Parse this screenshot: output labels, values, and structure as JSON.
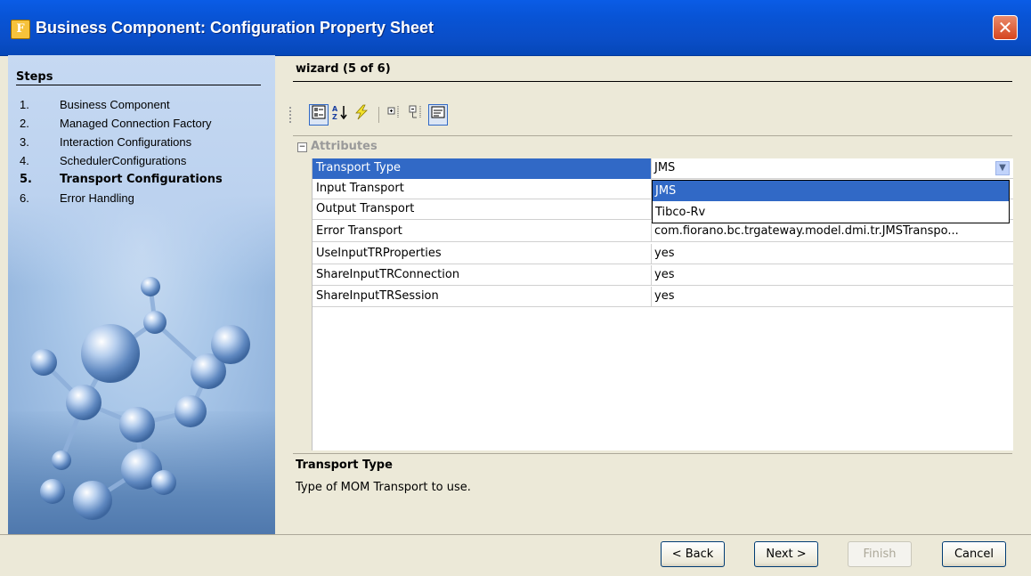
{
  "window": {
    "title": "Business Component: Configuration Property Sheet",
    "app_icon": "F",
    "close_glyph": "✕"
  },
  "sidebar": {
    "heading": "Steps",
    "steps": [
      {
        "num": "1.",
        "label": "Business Component"
      },
      {
        "num": "2.",
        "label": "Managed Connection Factory"
      },
      {
        "num": "3.",
        "label": "Interaction Configurations"
      },
      {
        "num": "4.",
        "label": "SchedulerConfigurations"
      },
      {
        "num": "5.",
        "label": "Transport Configurations"
      },
      {
        "num": "6.",
        "label": "Error Handling"
      }
    ],
    "current_step": 5
  },
  "main": {
    "heading": "wizard (5 of 6)",
    "toolbar": [
      {
        "icon": "categorized-view-icon"
      },
      {
        "icon": "sort-alphabetic-icon"
      },
      {
        "icon": "events-lightning-icon"
      },
      {
        "icon": "expand-all-icon"
      },
      {
        "icon": "collapse-all-icon"
      },
      {
        "icon": "show-description-icon"
      }
    ],
    "category": {
      "label": "Attributes",
      "toggle": "−"
    },
    "properties": [
      {
        "name": "Transport Type",
        "value": "JMS"
      },
      {
        "name": "Input Transport",
        "value": ""
      },
      {
        "name": "Output Transport",
        "value": ""
      },
      {
        "name": "Error Transport",
        "value": "com.fiorano.bc.trgateway.model.dmi.tr.JMSTranspo..."
      },
      {
        "name": "UseInputTRProperties",
        "value": "yes"
      },
      {
        "name": "ShareInputTRConnection",
        "value": "yes"
      },
      {
        "name": "ShareInputTRSession",
        "value": "yes"
      }
    ],
    "dropdown": {
      "options": [
        "JMS",
        "Tibco-Rv"
      ],
      "highlighted": "JMS",
      "arrow": "▼"
    },
    "description": {
      "title": "Transport Type",
      "text": "Type of MOM Transport to use."
    }
  },
  "buttons": {
    "back": "< Back",
    "next": "Next >",
    "finish": "Finish",
    "cancel": "Cancel"
  }
}
